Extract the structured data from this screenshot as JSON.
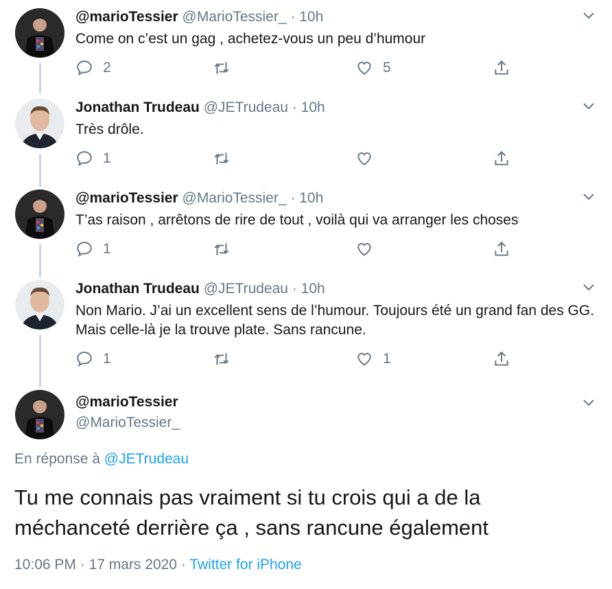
{
  "replies": [
    {
      "name": "@marioTessier",
      "handle": "@MarioTessier_",
      "sep": "·",
      "time": "10h",
      "text": "Come on c’est un gag , achetez-vous un peu d’humour",
      "reply_count": "2",
      "retweet_count": "",
      "like_count": "5",
      "avatar": "mario"
    },
    {
      "name": "Jonathan Trudeau",
      "handle": "@JETrudeau",
      "sep": "·",
      "time": "10h",
      "text": "Très drôle.",
      "reply_count": "1",
      "retweet_count": "",
      "like_count": "",
      "avatar": "jonathan"
    },
    {
      "name": "@marioTessier",
      "handle": "@MarioTessier_",
      "sep": "·",
      "time": "10h",
      "text": "T’as raison , arrêtons de rire de tout , voilà qui va arranger les choses",
      "reply_count": "1",
      "retweet_count": "",
      "like_count": "",
      "avatar": "mario"
    },
    {
      "name": "Jonathan Trudeau",
      "handle": "@JETrudeau",
      "sep": "·",
      "time": "10h",
      "text": "Non Mario. J’ai un excellent sens de l’humour. Toujours été un grand fan des GG. Mais celle-là je la trouve plate. Sans rancune.",
      "reply_count": "1",
      "retweet_count": "",
      "like_count": "1",
      "avatar": "jonathan"
    }
  ],
  "main_tweet": {
    "name": "@marioTessier",
    "handle": "@MarioTessier_",
    "reply_prefix": "En réponse à",
    "reply_target": "@JETrudeau",
    "text": "Tu me connais pas vraiment si tu crois qui a de la méchanceté derrière ça , sans rancune également",
    "time": "10:06 PM",
    "date": "17 mars 2020",
    "sep": "·",
    "source": "Twitter for iPhone"
  },
  "colors": {
    "text": "#14171a",
    "secondary": "#657786",
    "link": "#1da1f2",
    "thread_line": "#ccd6dd"
  }
}
